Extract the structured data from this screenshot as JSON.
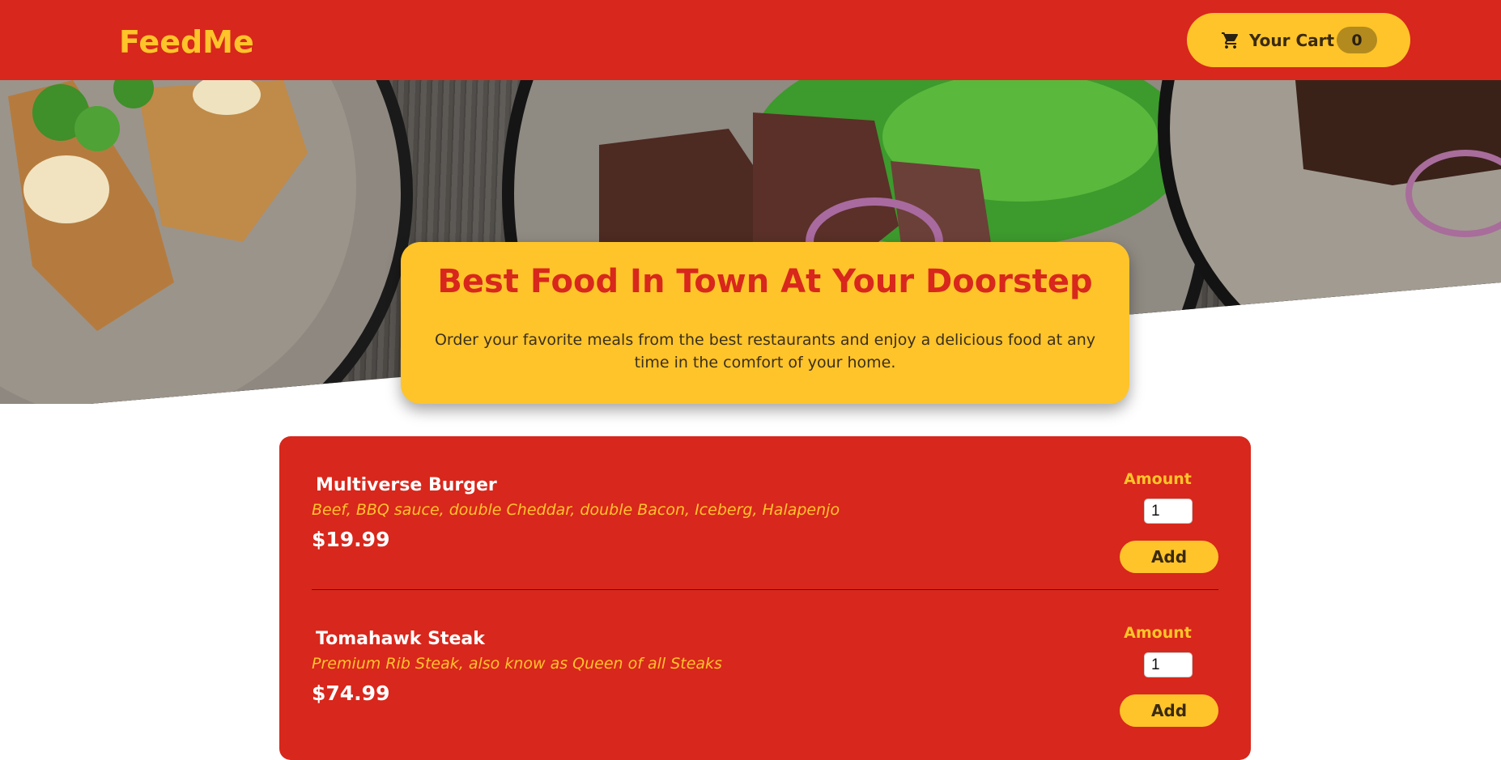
{
  "header": {
    "logo": "FeedMe",
    "cart_label": "Your Cart",
    "cart_count": "0"
  },
  "hero": {
    "title": "Best Food In Town At Your Doorstep",
    "text": "Order your favorite meals from the best restaurants and enjoy a delicious food at any time in the comfort of your home."
  },
  "meals": [
    {
      "name": "Multiverse Burger",
      "description": "Beef, BBQ sauce, double Cheddar, double Bacon, Iceberg, Halapenjo",
      "price": "$19.99",
      "amount_label": "Amount",
      "amount_value": "1",
      "add_label": "Add"
    },
    {
      "name": "Tomahawk Steak",
      "description": "Premium Rib Steak, also know as Queen of all Steaks",
      "price": "$74.99",
      "amount_label": "Amount",
      "amount_value": "1",
      "add_label": "Add"
    }
  ],
  "colors": {
    "primary_red": "#d8271c",
    "accent_yellow": "#ffc42a",
    "badge": "#b38a1e"
  },
  "icons": {
    "cart": "shopping-cart-icon"
  }
}
